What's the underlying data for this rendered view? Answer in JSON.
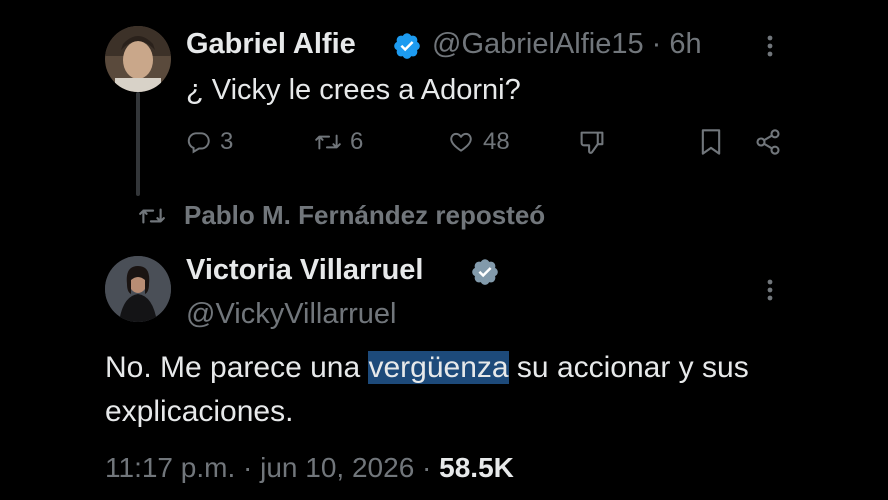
{
  "tweet1": {
    "name": "Gabriel Alfie",
    "handle": "@GabrielAlfie15",
    "separator": "·",
    "time": "6h",
    "text": "¿ Vicky le crees a Adorni?",
    "actions": {
      "replies": "3",
      "reposts": "6",
      "likes": "48"
    }
  },
  "repost_notice": "Pablo M. Fernández reposteó",
  "tweet2": {
    "name": "Victoria Villarruel",
    "handle": "@VickyVillarruel",
    "text_before": "No. Me parece una ",
    "text_highlight": "vergüenza",
    "text_after": " su accionar y sus explicaciones.",
    "time": "11:17 p.m.",
    "separator": "·",
    "date": "jun 10, 2026",
    "separator2": "·",
    "views": "58.5K"
  },
  "colors": {
    "background": "#000000",
    "text": "#e7e9ea",
    "muted": "#71767b",
    "verified": "#1d9bf0",
    "verified_gray": "#829aab",
    "highlight": "#1d4a7a"
  }
}
